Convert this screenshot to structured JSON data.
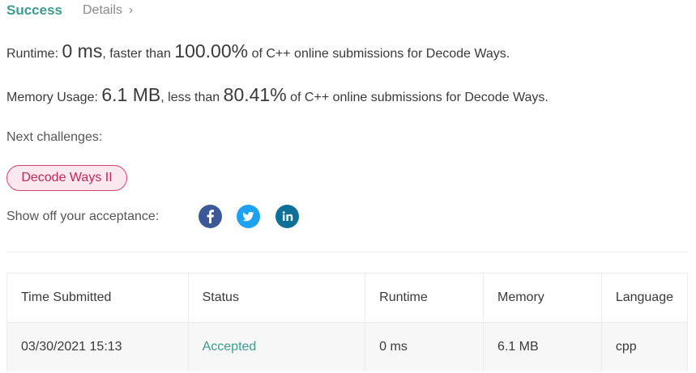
{
  "header": {
    "status": "Success",
    "details_label": "Details"
  },
  "runtime": {
    "label": "Runtime:",
    "value": "0 ms",
    "comparison": "faster than",
    "percent": "100.00%",
    "suffix": "of C++ online submissions for Decode Ways."
  },
  "memory": {
    "label": "Memory Usage:",
    "value": "6.1 MB",
    "comparison": "less than",
    "percent": "80.41%",
    "suffix": "of C++ online submissions for Decode Ways."
  },
  "next_challenges": {
    "label": "Next challenges:",
    "items": [
      "Decode Ways II"
    ]
  },
  "share": {
    "label": "Show off your acceptance:",
    "icons": [
      "facebook-icon",
      "twitter-icon",
      "linkedin-icon"
    ]
  },
  "table": {
    "headers": [
      "Time Submitted",
      "Status",
      "Runtime",
      "Memory",
      "Language"
    ],
    "rows": [
      [
        "03/30/2021 15:13",
        "Accepted",
        "0 ms",
        "6.1 MB",
        "cpp"
      ]
    ]
  },
  "colors": {
    "success": "#3d9b8f",
    "chip_border": "#d8406e",
    "facebook": "#3b5998",
    "twitter": "#1da1f2",
    "linkedin": "#0e6f99"
  }
}
